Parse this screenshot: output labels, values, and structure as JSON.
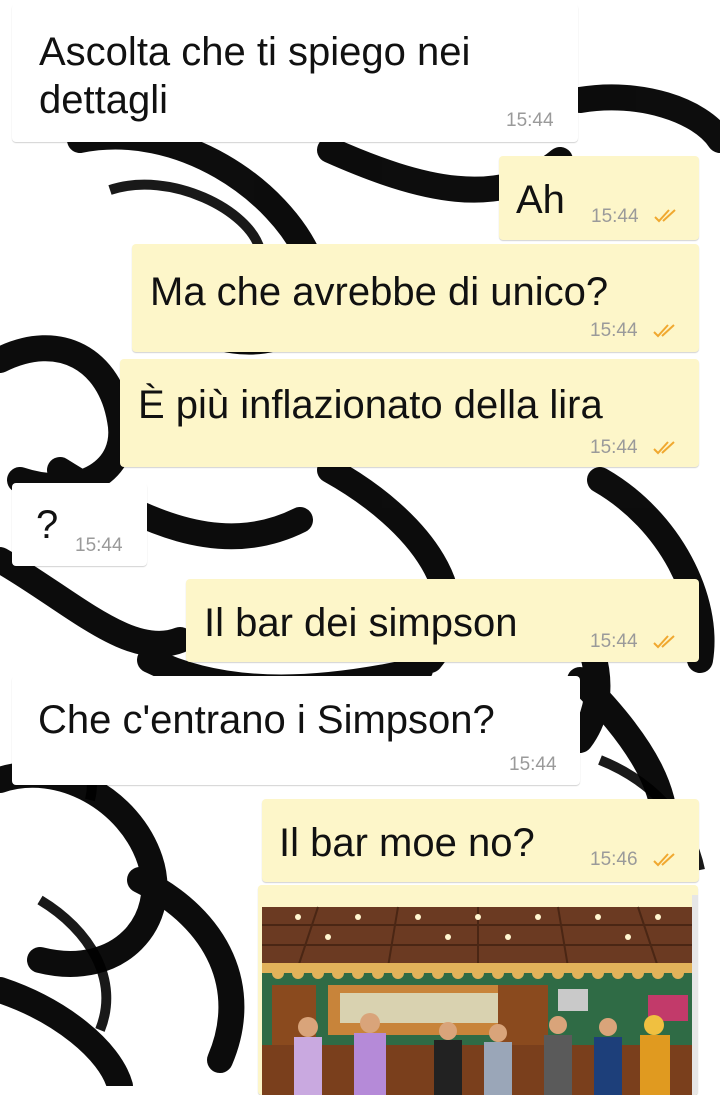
{
  "chat": {
    "messages": [
      {
        "text": "Ascolta che ti spiego nei dettagli",
        "time": "15:44",
        "dir": "in"
      },
      {
        "text": "Ah",
        "time": "15:44",
        "dir": "out"
      },
      {
        "text": "Ma che avrebbe di unico?",
        "time": "15:44",
        "dir": "out"
      },
      {
        "text": "È più inflazionato della lira",
        "time": "15:44",
        "dir": "out"
      },
      {
        "text": "?",
        "time": "15:44",
        "dir": "in"
      },
      {
        "text": "Il bar dei simpson",
        "time": "15:44",
        "dir": "out"
      },
      {
        "text": "Che c'entrano i Simpson?",
        "time": "15:44",
        "dir": "in"
      },
      {
        "text": "Il bar moe no?",
        "time": "15:46",
        "dir": "out"
      }
    ],
    "photo": {
      "icon": "bar-interior-photo"
    }
  },
  "colors": {
    "incoming_bubble": "#ffffff",
    "outgoing_bubble": "#fdf6c9",
    "read_ticks": "#f0a830",
    "timestamp": "#9a9a9a"
  }
}
